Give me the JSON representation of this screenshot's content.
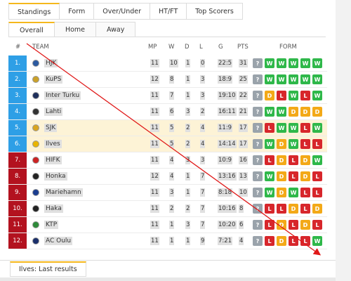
{
  "tabs": [
    "Standings",
    "Form",
    "Over/Under",
    "HT/FT",
    "Top Scorers"
  ],
  "subtabs": [
    "Overall",
    "Home",
    "Away"
  ],
  "columns": {
    "rank": "#",
    "team": "TEAM",
    "mp": "MP",
    "w": "W",
    "d": "D",
    "l": "L",
    "g": "G",
    "pts": "PTS",
    "form": "FORM"
  },
  "colors": {
    "promotion": "#2e9fe6",
    "relegation": "#b3121f",
    "highlight": "#fdf3d6",
    "accent": "#f5b81c",
    "win": "#2fb84a",
    "draw": "#f3a918",
    "loss": "#d7262b",
    "next": "#9aa3ab"
  },
  "rows": [
    {
      "rank": "1.",
      "team": "HJK",
      "mp": "11",
      "w": "10",
      "d": "1",
      "l": "0",
      "g": "22:5",
      "pts": "31",
      "form": [
        "?",
        "W",
        "W",
        "W",
        "W",
        "W"
      ],
      "zone": "promotion",
      "highlight": false,
      "logo": "#2c5aa0"
    },
    {
      "rank": "2.",
      "team": "KuPS",
      "mp": "12",
      "w": "8",
      "d": "1",
      "l": "3",
      "g": "18:9",
      "pts": "25",
      "form": [
        "?",
        "W",
        "W",
        "W",
        "W",
        "W"
      ],
      "zone": "promotion",
      "highlight": false,
      "logo": "#caa12a"
    },
    {
      "rank": "3.",
      "team": "Inter Turku",
      "mp": "11",
      "w": "7",
      "d": "1",
      "l": "3",
      "g": "19:10",
      "pts": "22",
      "form": [
        "?",
        "D",
        "L",
        "W",
        "L",
        "W"
      ],
      "zone": "promotion",
      "highlight": false,
      "logo": "#1f2f5c"
    },
    {
      "rank": "4.",
      "team": "Lahti",
      "mp": "11",
      "w": "6",
      "d": "3",
      "l": "2",
      "g": "16:11",
      "pts": "21",
      "form": [
        "?",
        "W",
        "W",
        "D",
        "D",
        "D"
      ],
      "zone": "promotion",
      "highlight": false,
      "logo": "#333333"
    },
    {
      "rank": "5.",
      "team": "SJK",
      "mp": "11",
      "w": "5",
      "d": "2",
      "l": "4",
      "g": "11:9",
      "pts": "17",
      "form": [
        "?",
        "L",
        "W",
        "W",
        "L",
        "W"
      ],
      "zone": "promotion",
      "highlight": true,
      "logo": "#d9a520"
    },
    {
      "rank": "6.",
      "team": "Ilves",
      "mp": "11",
      "w": "5",
      "d": "2",
      "l": "4",
      "g": "14:14",
      "pts": "17",
      "form": [
        "?",
        "W",
        "D",
        "W",
        "L",
        "L"
      ],
      "zone": "promotion",
      "highlight": true,
      "logo": "#e8b400"
    },
    {
      "rank": "7.",
      "team": "HIFK",
      "mp": "11",
      "w": "4",
      "d": "3",
      "l": "3",
      "g": "10:9",
      "pts": "16",
      "form": [
        "?",
        "L",
        "D",
        "L",
        "D",
        "W"
      ],
      "zone": "relegation",
      "highlight": false,
      "logo": "#cc2222"
    },
    {
      "rank": "8.",
      "team": "Honka",
      "mp": "12",
      "w": "4",
      "d": "1",
      "l": "7",
      "g": "13:16",
      "pts": "13",
      "form": [
        "?",
        "W",
        "D",
        "L",
        "D",
        "L"
      ],
      "zone": "relegation",
      "highlight": false,
      "logo": "#222222"
    },
    {
      "rank": "9.",
      "team": "Mariehamn",
      "mp": "11",
      "w": "3",
      "d": "1",
      "l": "7",
      "g": "8:18",
      "pts": "10",
      "form": [
        "?",
        "W",
        "D",
        "W",
        "L",
        "L"
      ],
      "zone": "relegation",
      "highlight": false,
      "logo": "#1a3d8f"
    },
    {
      "rank": "10.",
      "team": "Haka",
      "mp": "11",
      "w": "2",
      "d": "2",
      "l": "7",
      "g": "10:16",
      "pts": "8",
      "form": [
        "?",
        "L",
        "L",
        "D",
        "L",
        "D"
      ],
      "zone": "relegation",
      "highlight": false,
      "logo": "#222222"
    },
    {
      "rank": "11.",
      "team": "KTP",
      "mp": "11",
      "w": "1",
      "d": "3",
      "l": "7",
      "g": "10:20",
      "pts": "6",
      "form": [
        "?",
        "L",
        "D",
        "L",
        "D",
        "L"
      ],
      "zone": "relegation",
      "highlight": false,
      "logo": "#2e8b3a"
    },
    {
      "rank": "12.",
      "team": "AC Oulu",
      "mp": "11",
      "w": "1",
      "d": "1",
      "l": "9",
      "g": "7:21",
      "pts": "4",
      "form": [
        "?",
        "L",
        "D",
        "L",
        "L",
        "W"
      ],
      "zone": "relegation",
      "highlight": false,
      "logo": "#1a2f6b"
    }
  ],
  "last_results": {
    "label": "Ilves: Last results"
  }
}
